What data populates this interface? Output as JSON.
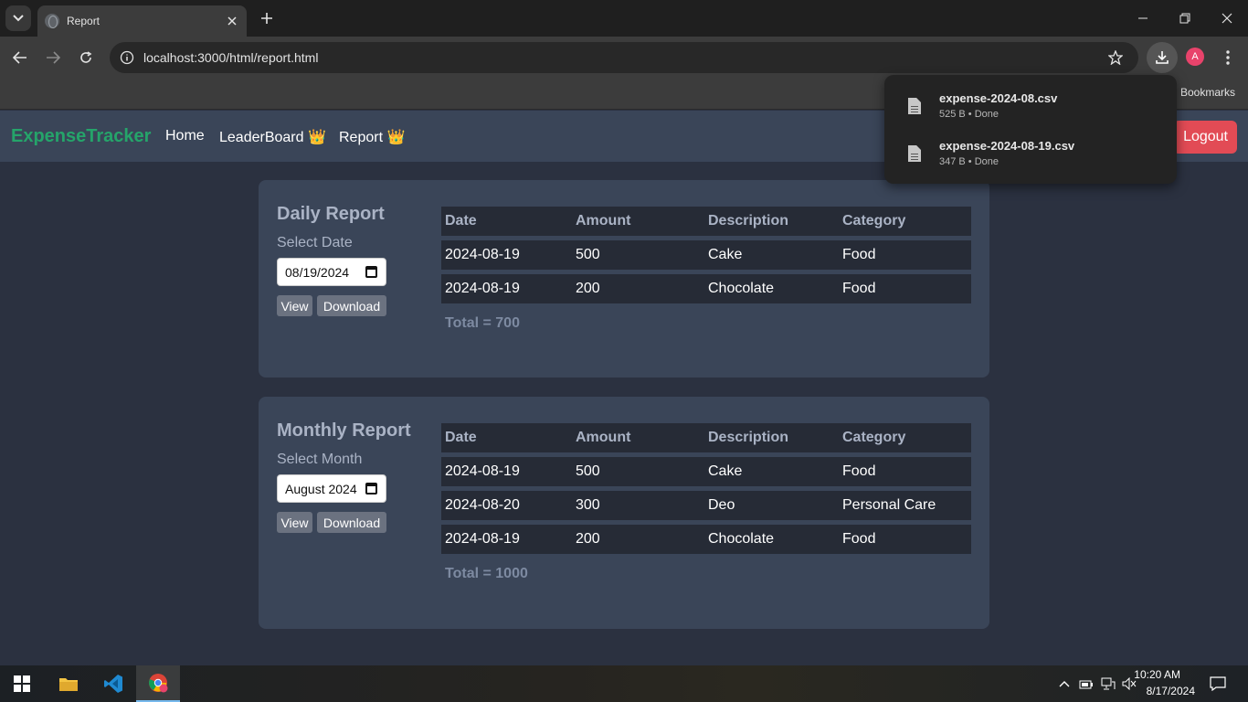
{
  "browser": {
    "tab_title": "Report",
    "url": "localhost:3000/html/report.html",
    "bookmarks_label": "Bookmarks",
    "profile_initial": "A",
    "icons": [
      "tab-search-icon",
      "globe-icon",
      "close-icon",
      "plus-icon",
      "minimize-icon",
      "restore-icon",
      "close-window-icon",
      "back-icon",
      "forward-icon",
      "reload-icon",
      "site-info-icon",
      "star-icon",
      "download-icon",
      "kebab-icon"
    ]
  },
  "downloads": [
    {
      "name": "expense-2024-08.csv",
      "meta": "525 B • Done"
    },
    {
      "name": "expense-2024-08-19.csv",
      "meta": "347 B • Done"
    }
  ],
  "navbar": {
    "brand": "ExpenseTracker",
    "links": [
      "Home",
      "LeaderBoard 👑",
      "Report 👑"
    ],
    "logout_label": "Logout",
    "brand_color": "#25a46a",
    "logout_color": "#e24b55"
  },
  "daily": {
    "title": "Daily Report",
    "select_label": "Select Date",
    "input_value": "08/19/2024",
    "view_label": "View",
    "download_label": "Download",
    "headers": [
      "Date",
      "Amount",
      "Description",
      "Category"
    ],
    "rows": [
      [
        "2024-08-19",
        "500",
        "Cake",
        "Food"
      ],
      [
        "2024-08-19",
        "200",
        "Chocolate",
        "Food"
      ]
    ],
    "total": "Total = 700"
  },
  "monthly": {
    "title": "Monthly Report",
    "select_label": "Select Month",
    "input_value": "August 2024",
    "view_label": "View",
    "download_label": "Download",
    "headers": [
      "Date",
      "Amount",
      "Description",
      "Category"
    ],
    "rows": [
      [
        "2024-08-19",
        "500",
        "Cake",
        "Food"
      ],
      [
        "2024-08-20",
        "300",
        "Deo",
        "Personal Care"
      ],
      [
        "2024-08-19",
        "200",
        "Chocolate",
        "Food"
      ]
    ],
    "total": "Total = 1000"
  },
  "taskbar": {
    "time": "10:20 AM",
    "date": "8/17/2024",
    "apps": [
      "windows-start-icon",
      "file-explorer-icon",
      "vscode-icon",
      "chrome-icon"
    ]
  }
}
